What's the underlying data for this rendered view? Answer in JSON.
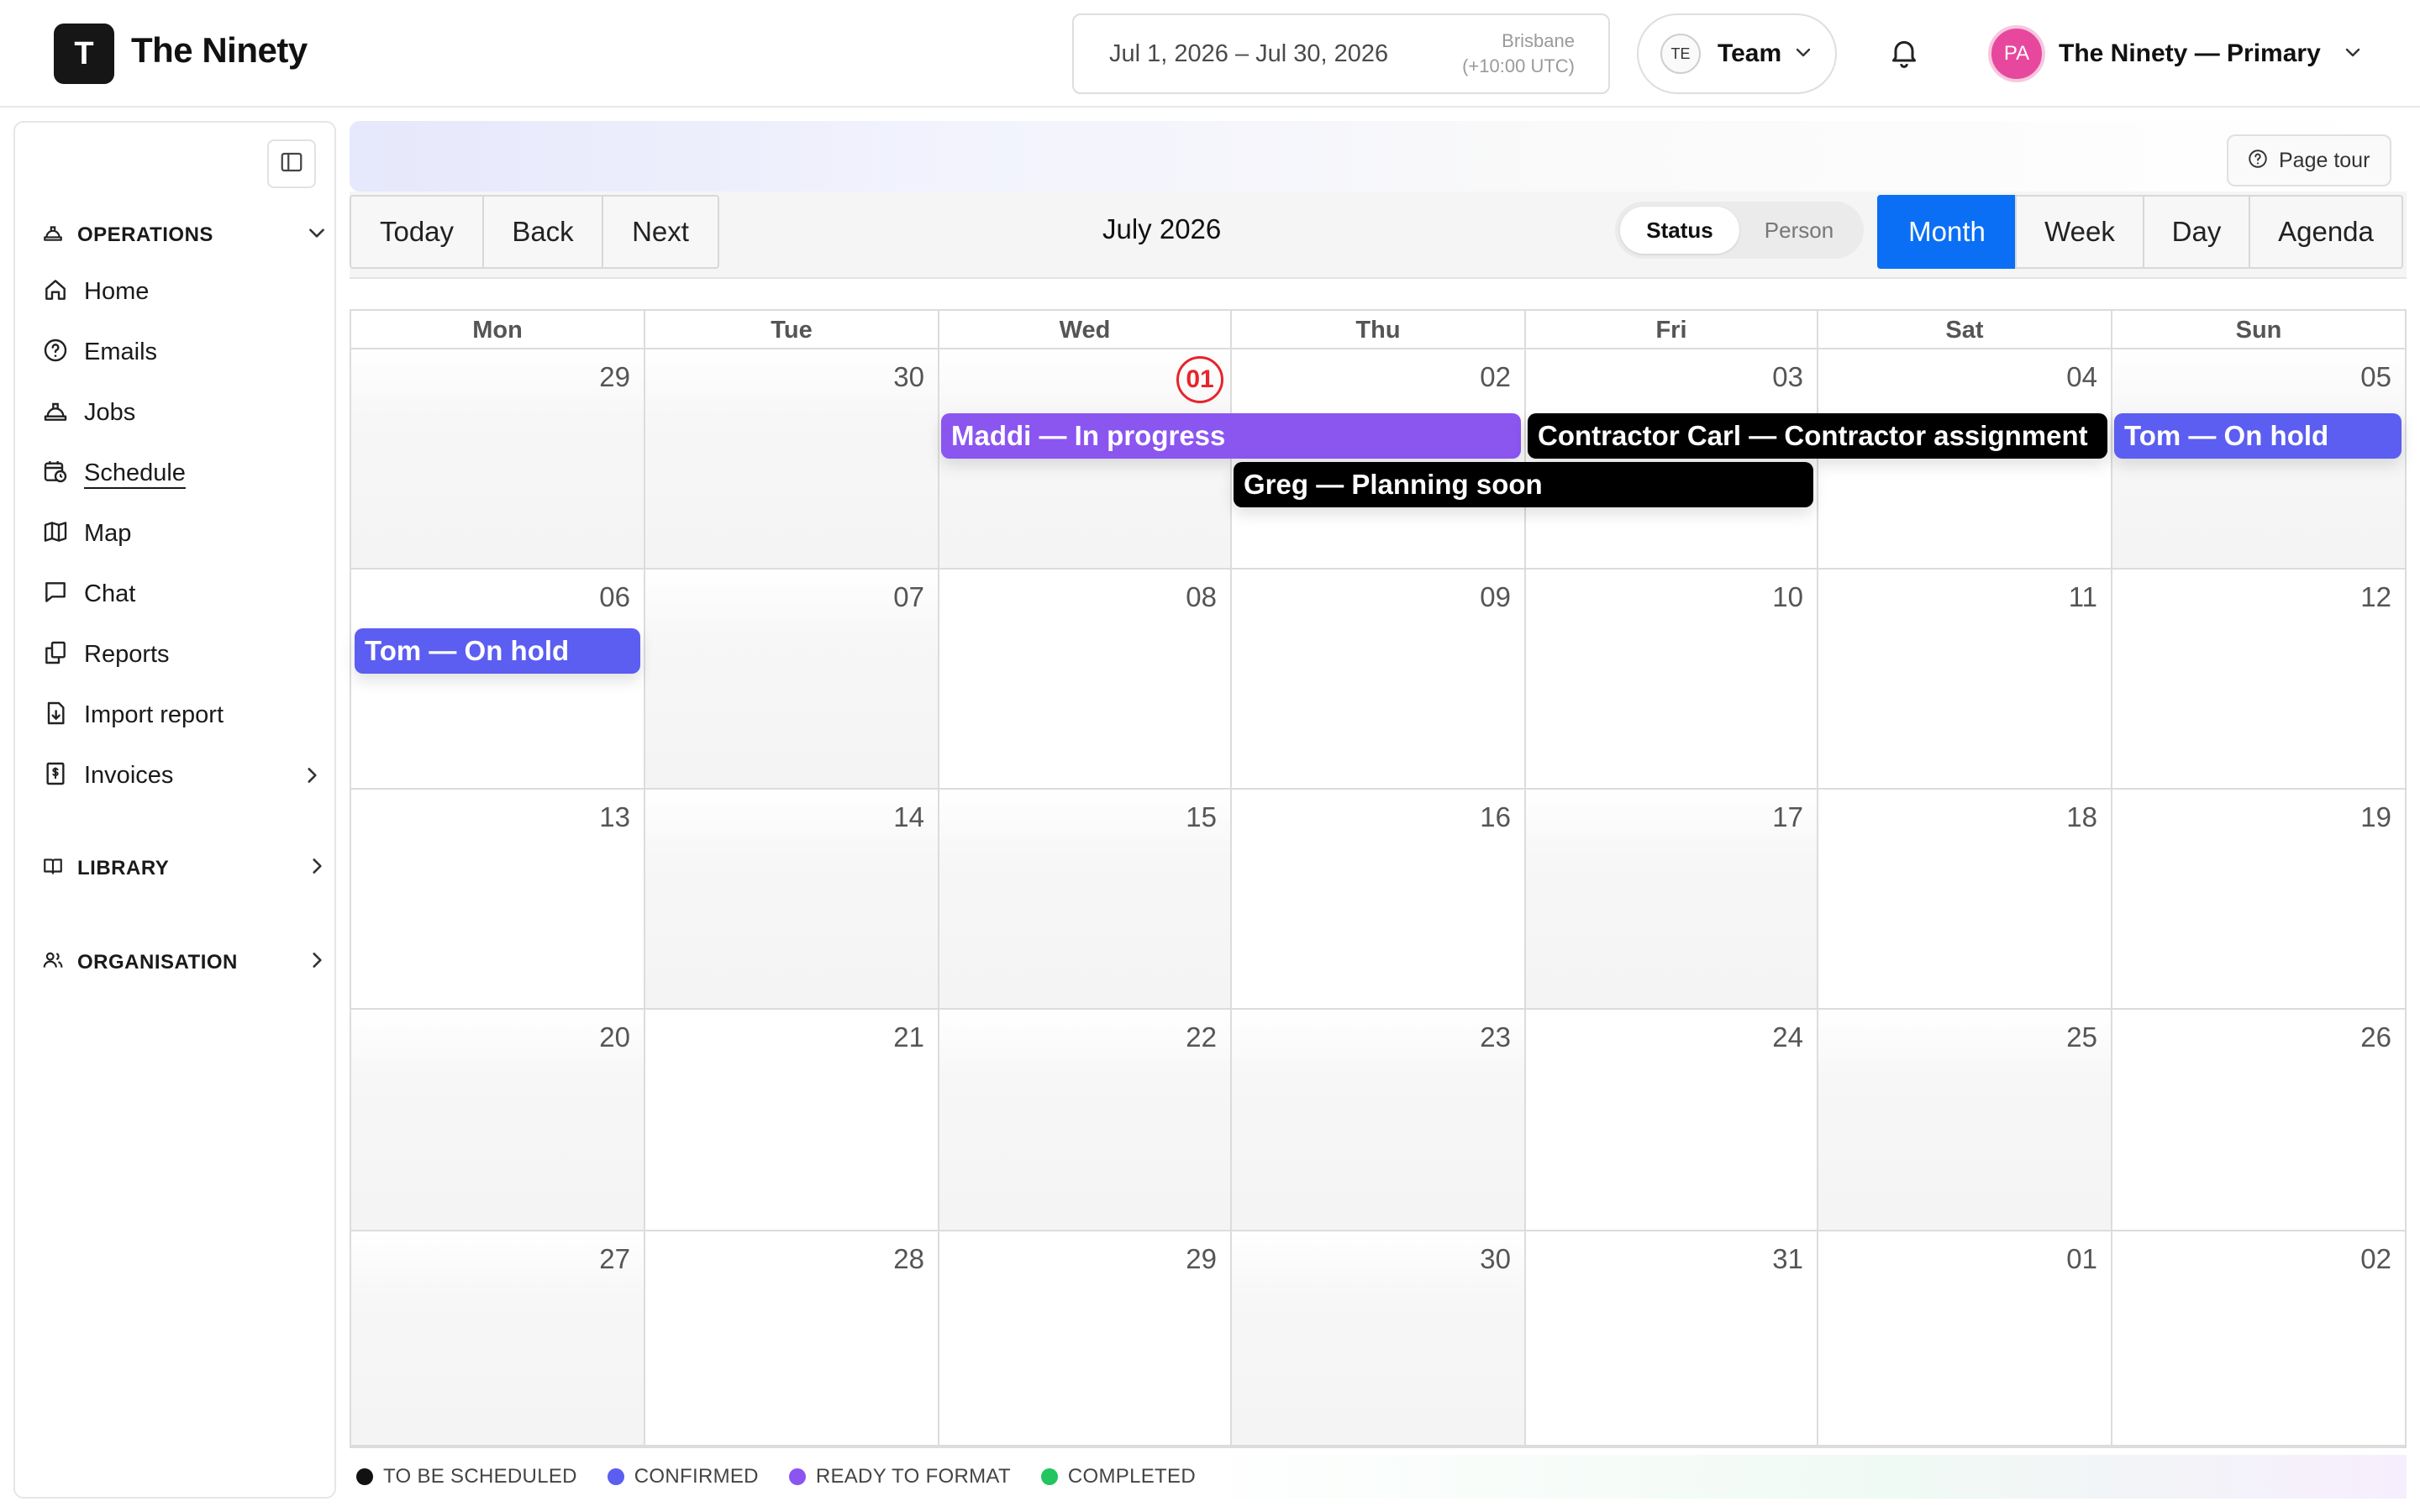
{
  "app": {
    "logo_letter": "T",
    "title": "The Ninety"
  },
  "header": {
    "date_range": "Jul 1, 2026 – Jul 30, 2026",
    "timezone_city": "Brisbane",
    "timezone_offset": "(+10:00 UTC)",
    "team_initials": "TE",
    "team_label": "Team",
    "account_initials": "PA",
    "account_name": "The Ninety — Primary"
  },
  "sidebar": {
    "operations_label": "OPERATIONS",
    "items": [
      {
        "label": "Home",
        "icon": "home-icon"
      },
      {
        "label": "Emails",
        "icon": "at-sign-icon"
      },
      {
        "label": "Jobs",
        "icon": "hard-hat-icon"
      },
      {
        "label": "Schedule",
        "icon": "calendar-clock-icon",
        "active": true
      },
      {
        "label": "Map",
        "icon": "map-icon"
      },
      {
        "label": "Chat",
        "icon": "chat-icon"
      },
      {
        "label": "Reports",
        "icon": "reports-icon"
      },
      {
        "label": "Import report",
        "icon": "file-import-icon"
      },
      {
        "label": "Invoices",
        "icon": "dollar-file-icon"
      }
    ],
    "library_label": "LIBRARY",
    "organisation_label": "ORGANISATION"
  },
  "main": {
    "page_tour_label": "Page tour",
    "nav_buttons": [
      "Today",
      "Back",
      "Next"
    ],
    "month_label": "July 2026",
    "segment_options": [
      "Status",
      "Person"
    ],
    "segment_selected": "Status",
    "view_buttons": [
      "Month",
      "Week",
      "Day",
      "Agenda"
    ],
    "view_selected": "Month"
  },
  "calendar": {
    "weekdays": [
      "Mon",
      "Tue",
      "Wed",
      "Thu",
      "Fri",
      "Sat",
      "Sun"
    ],
    "weeks": [
      [
        "29",
        "30",
        "01",
        "02",
        "03",
        "04",
        "05"
      ],
      [
        "06",
        "07",
        "08",
        "09",
        "10",
        "11",
        "12"
      ],
      [
        "13",
        "14",
        "15",
        "16",
        "17",
        "18",
        "19"
      ],
      [
        "20",
        "21",
        "22",
        "23",
        "24",
        "25",
        "26"
      ],
      [
        "27",
        "28",
        "29",
        "30",
        "31",
        "01",
        "02"
      ]
    ],
    "today": "01",
    "events": [
      {
        "label": "Maddi — In progress",
        "color": "#8b55f0"
      },
      {
        "label": "Contractor Carl — Contractor assignment",
        "color": "#000000"
      },
      {
        "label": "Tom — On hold",
        "color": "#5b5ef0"
      },
      {
        "label": "Greg — Planning soon",
        "color": "#000000"
      },
      {
        "label": "Tom — On hold",
        "color": "#5b5ef0"
      }
    ]
  },
  "legend": [
    {
      "label": "TO BE SCHEDULED",
      "color": "#111111"
    },
    {
      "label": "CONFIRMED",
      "color": "#5b5ef0"
    },
    {
      "label": "READY TO FORMAT",
      "color": "#8b55f0"
    },
    {
      "label": "COMPLETED",
      "color": "#22c55e"
    }
  ]
}
